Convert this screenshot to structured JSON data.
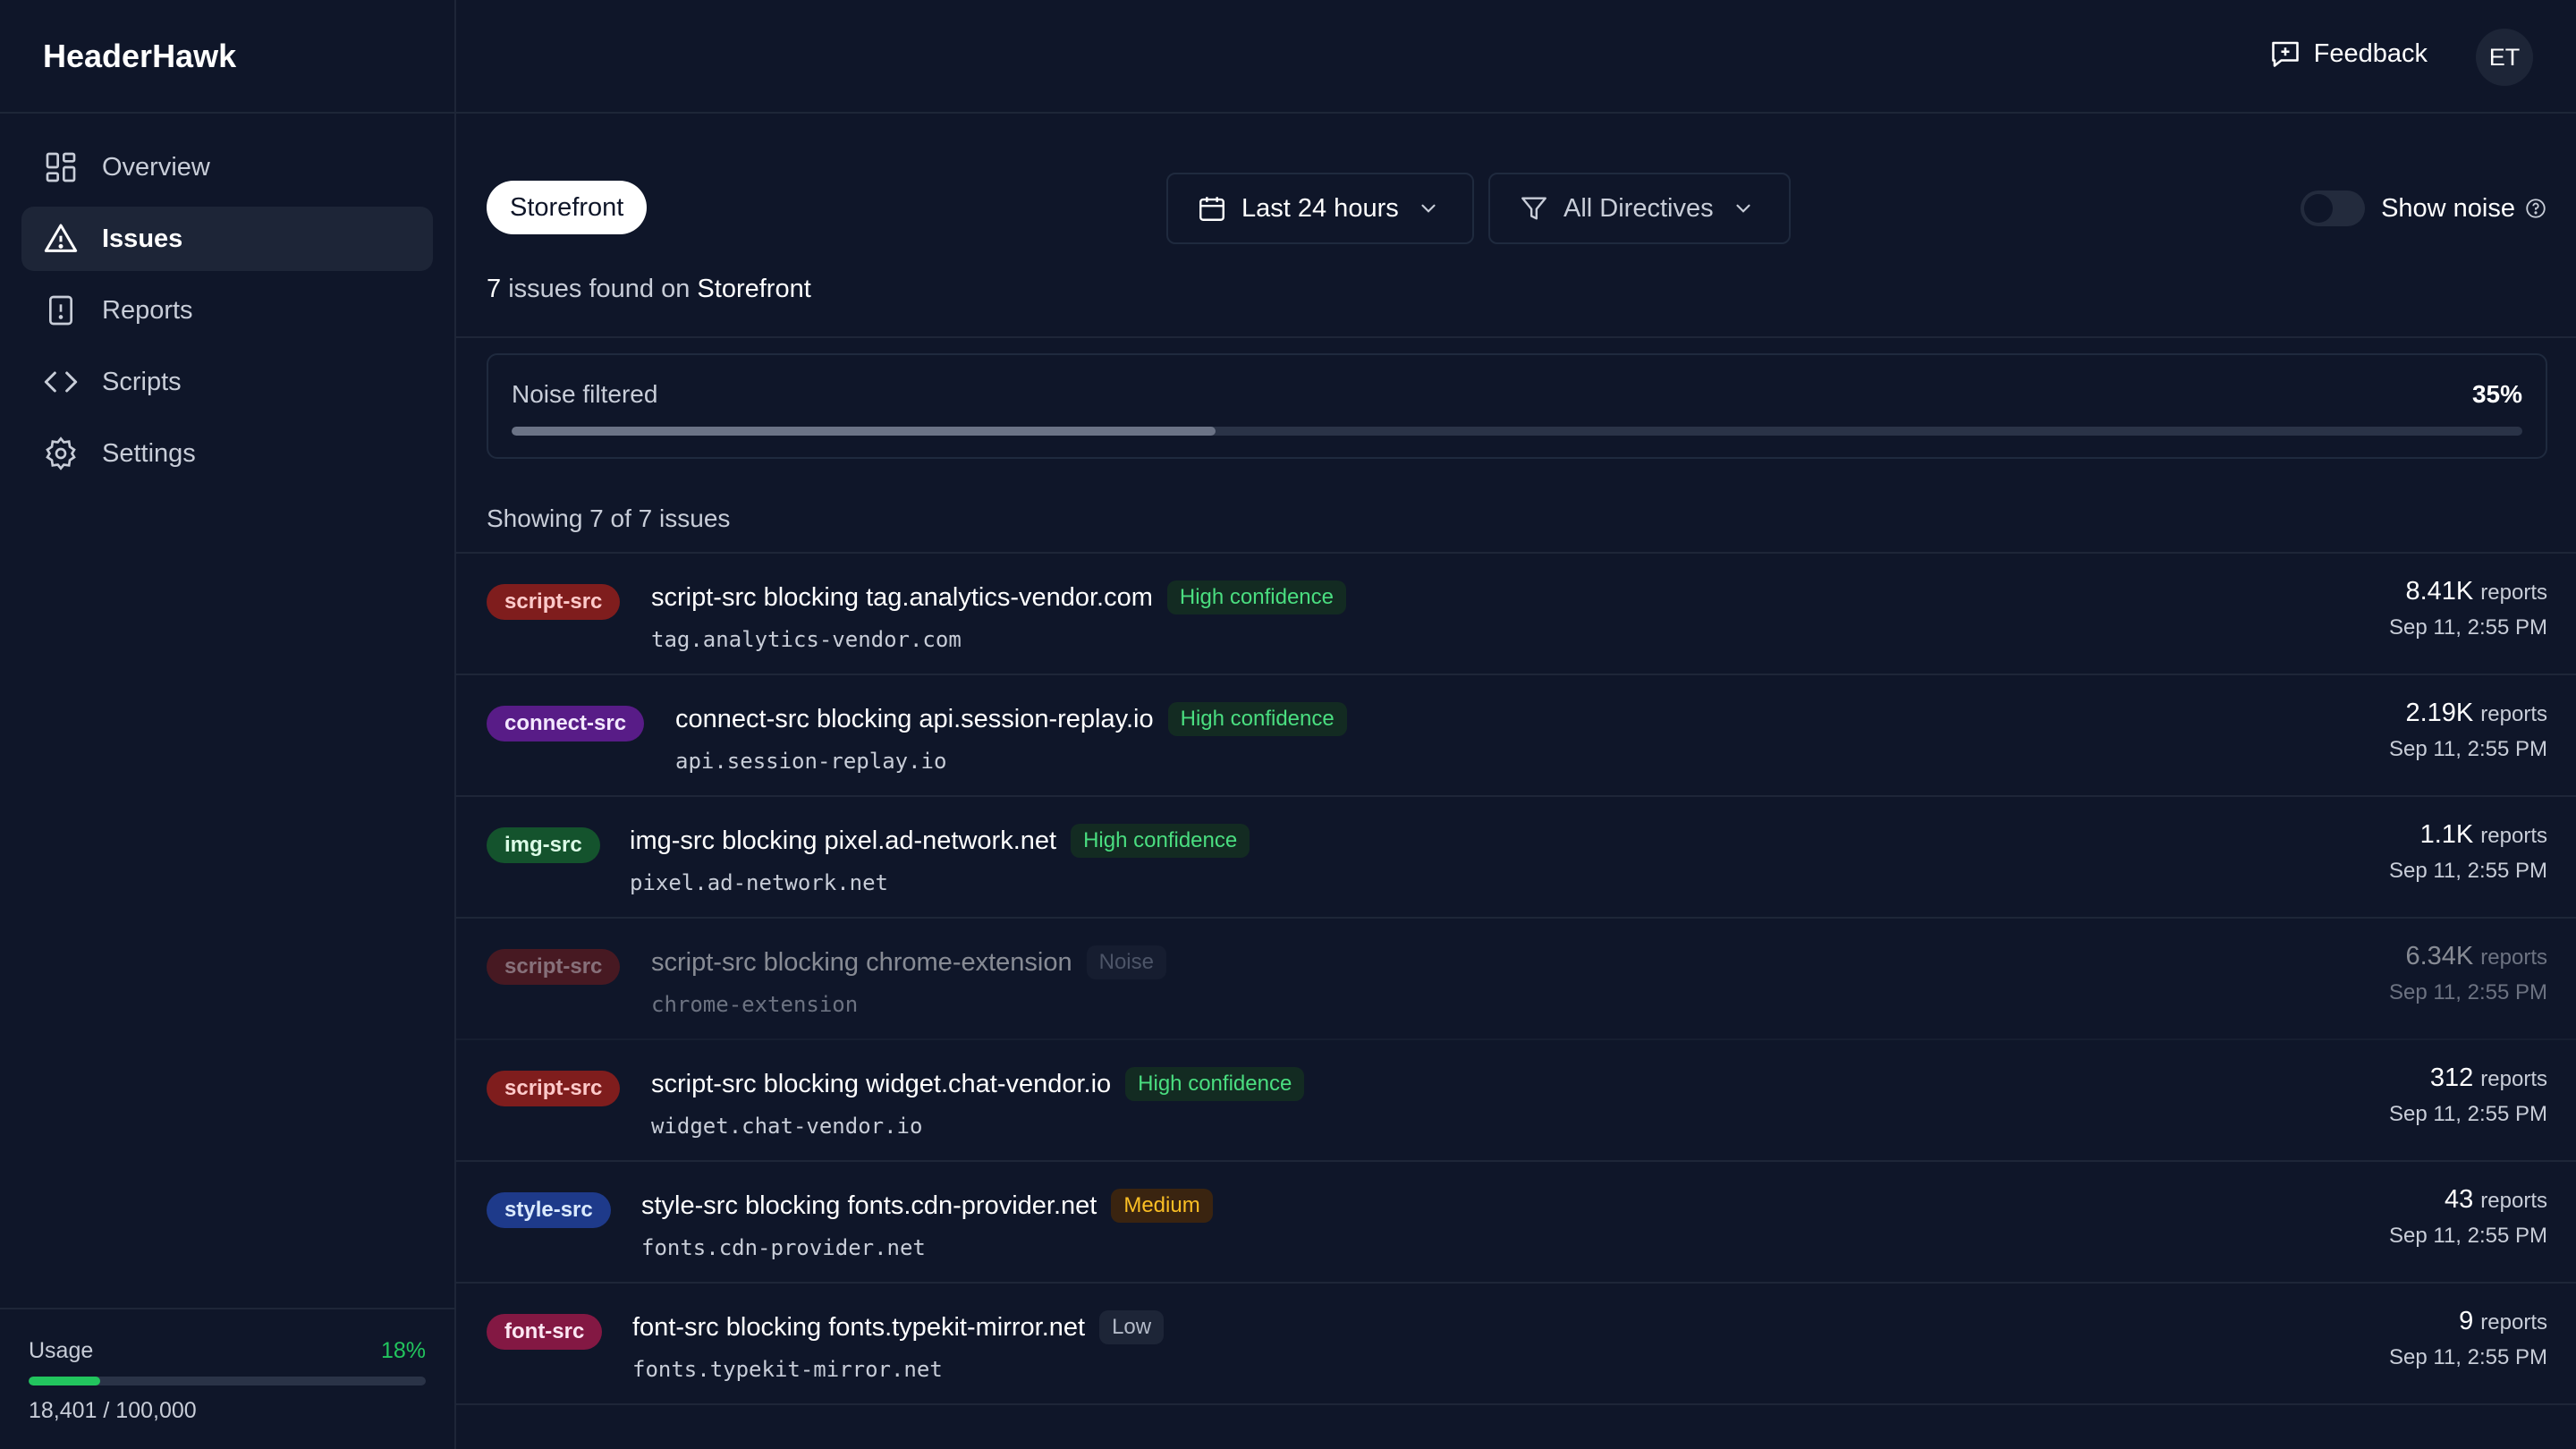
{
  "brand": "HeaderHawk",
  "sidebar": {
    "items": [
      {
        "label": "Overview"
      },
      {
        "label": "Issues"
      },
      {
        "label": "Reports"
      },
      {
        "label": "Scripts"
      },
      {
        "label": "Settings"
      }
    ],
    "usage": {
      "label": "Usage",
      "percent": "18%",
      "fraction": 0.18,
      "count": "18,401 / 100,000"
    }
  },
  "header": {
    "feedback": "Feedback",
    "avatar_initials": "ET"
  },
  "controls": {
    "site": "Storefront",
    "time_range": "Last 24 hours",
    "directives": "All Directives",
    "show_noise": "Show noise"
  },
  "summary": {
    "count": "7",
    "text": "issues found on",
    "site": "Storefront"
  },
  "noise": {
    "label": "Noise filtered",
    "value": "35%",
    "fraction": 0.35
  },
  "showing": "Showing 7 of 7 issues",
  "issues": [
    {
      "directive": "script-src",
      "title": "script-src blocking tag.analytics-vendor.com",
      "confidence": "High confidence",
      "host": "tag.analytics-vendor.com",
      "count": "8.41K",
      "unit": "reports",
      "date": "Sep 11, 2:55 PM"
    },
    {
      "directive": "connect-src",
      "title": "connect-src blocking api.session-replay.io",
      "confidence": "High confidence",
      "host": "api.session-replay.io",
      "count": "2.19K",
      "unit": "reports",
      "date": "Sep 11, 2:55 PM"
    },
    {
      "directive": "img-src",
      "title": "img-src blocking pixel.ad-network.net",
      "confidence": "High confidence",
      "host": "pixel.ad-network.net",
      "count": "1.1K",
      "unit": "reports",
      "date": "Sep 11, 2:55 PM"
    },
    {
      "directive": "script-src",
      "title": "script-src blocking chrome-extension",
      "confidence": "Noise",
      "host": "chrome-extension",
      "count": "6.34K",
      "unit": "reports",
      "date": "Sep 11, 2:55 PM"
    },
    {
      "directive": "script-src",
      "title": "script-src blocking widget.chat-vendor.io",
      "confidence": "High confidence",
      "host": "widget.chat-vendor.io",
      "count": "312",
      "unit": "reports",
      "date": "Sep 11, 2:55 PM"
    },
    {
      "directive": "style-src",
      "title": "style-src blocking fonts.cdn-provider.net",
      "confidence": "Medium",
      "host": "fonts.cdn-provider.net",
      "count": "43",
      "unit": "reports",
      "date": "Sep 11, 2:55 PM"
    },
    {
      "directive": "font-src",
      "title": "font-src blocking fonts.typekit-mirror.net",
      "confidence": "Low",
      "host": "fonts.typekit-mirror.net",
      "count": "9",
      "unit": "reports",
      "date": "Sep 11, 2:55 PM"
    }
  ]
}
